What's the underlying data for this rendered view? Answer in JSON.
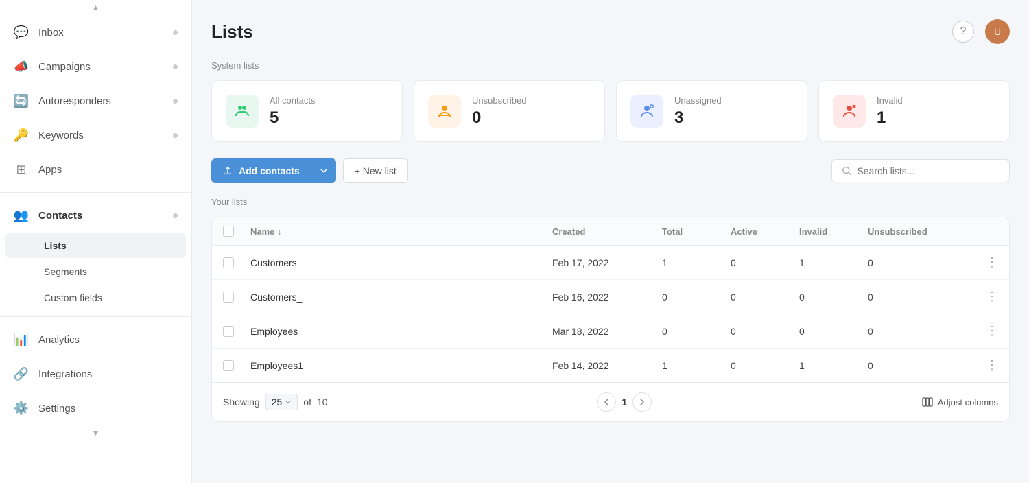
{
  "sidebar": {
    "scroll_up": "▲",
    "scroll_down": "▼",
    "items": [
      {
        "id": "inbox",
        "label": "Inbox",
        "icon": "💬",
        "dot": true
      },
      {
        "id": "campaigns",
        "label": "Campaigns",
        "icon": "📣",
        "dot": true
      },
      {
        "id": "autoresponders",
        "label": "Autoresponders",
        "icon": "🔑",
        "dot": true
      },
      {
        "id": "keywords",
        "label": "Keywords",
        "icon": "🔒",
        "dot": true
      },
      {
        "id": "apps",
        "label": "Apps",
        "icon": "⊞",
        "dot": false
      }
    ],
    "contacts": {
      "label": "Contacts",
      "dot": true,
      "sub_items": [
        {
          "id": "lists",
          "label": "Lists",
          "active": true
        },
        {
          "id": "segments",
          "label": "Segments"
        },
        {
          "id": "custom-fields",
          "label": "Custom fields"
        }
      ]
    },
    "bottom_items": [
      {
        "id": "analytics",
        "label": "Analytics",
        "icon": "📊"
      },
      {
        "id": "integrations",
        "label": "Integrations",
        "icon": "🔗"
      },
      {
        "id": "settings",
        "label": "Settings",
        "icon": "⚙️"
      }
    ]
  },
  "page": {
    "title": "Lists"
  },
  "system_lists": {
    "label": "System lists",
    "cards": [
      {
        "id": "all-contacts",
        "label": "All contacts",
        "count": "5",
        "icon_class": "green",
        "icon": "👥"
      },
      {
        "id": "unsubscribed",
        "label": "Unsubscribed",
        "count": "0",
        "icon_class": "orange",
        "icon": "👤"
      },
      {
        "id": "unassigned",
        "label": "Unassigned",
        "count": "3",
        "icon_class": "blue",
        "icon": "👤"
      },
      {
        "id": "invalid",
        "label": "Invalid",
        "count": "1",
        "icon_class": "red",
        "icon": "👤"
      }
    ]
  },
  "toolbar": {
    "add_contacts_label": "Add contacts",
    "new_list_label": "+ New list",
    "search_placeholder": "Search lists..."
  },
  "your_lists": {
    "label": "Your lists",
    "columns": [
      "Name ↓",
      "Created",
      "Total",
      "Active",
      "Invalid",
      "Unsubscribed"
    ],
    "rows": [
      {
        "name": "Customers",
        "created": "Feb 17, 2022",
        "total": "1",
        "active": "0",
        "invalid": "1",
        "unsubscribed": "0"
      },
      {
        "name": "Customers_",
        "created": "Feb 16, 2022",
        "total": "0",
        "active": "0",
        "invalid": "0",
        "unsubscribed": "0"
      },
      {
        "name": "Employees",
        "created": "Mar 18, 2022",
        "total": "0",
        "active": "0",
        "invalid": "0",
        "unsubscribed": "0"
      },
      {
        "name": "Employees1",
        "created": "Feb 14, 2022",
        "total": "1",
        "active": "0",
        "invalid": "1",
        "unsubscribed": "0"
      }
    ]
  },
  "pagination": {
    "showing_label": "Showing",
    "per_page": "25",
    "of_label": "of",
    "total": "10",
    "current_page": "1",
    "adjust_columns_label": "Adjust columns"
  }
}
